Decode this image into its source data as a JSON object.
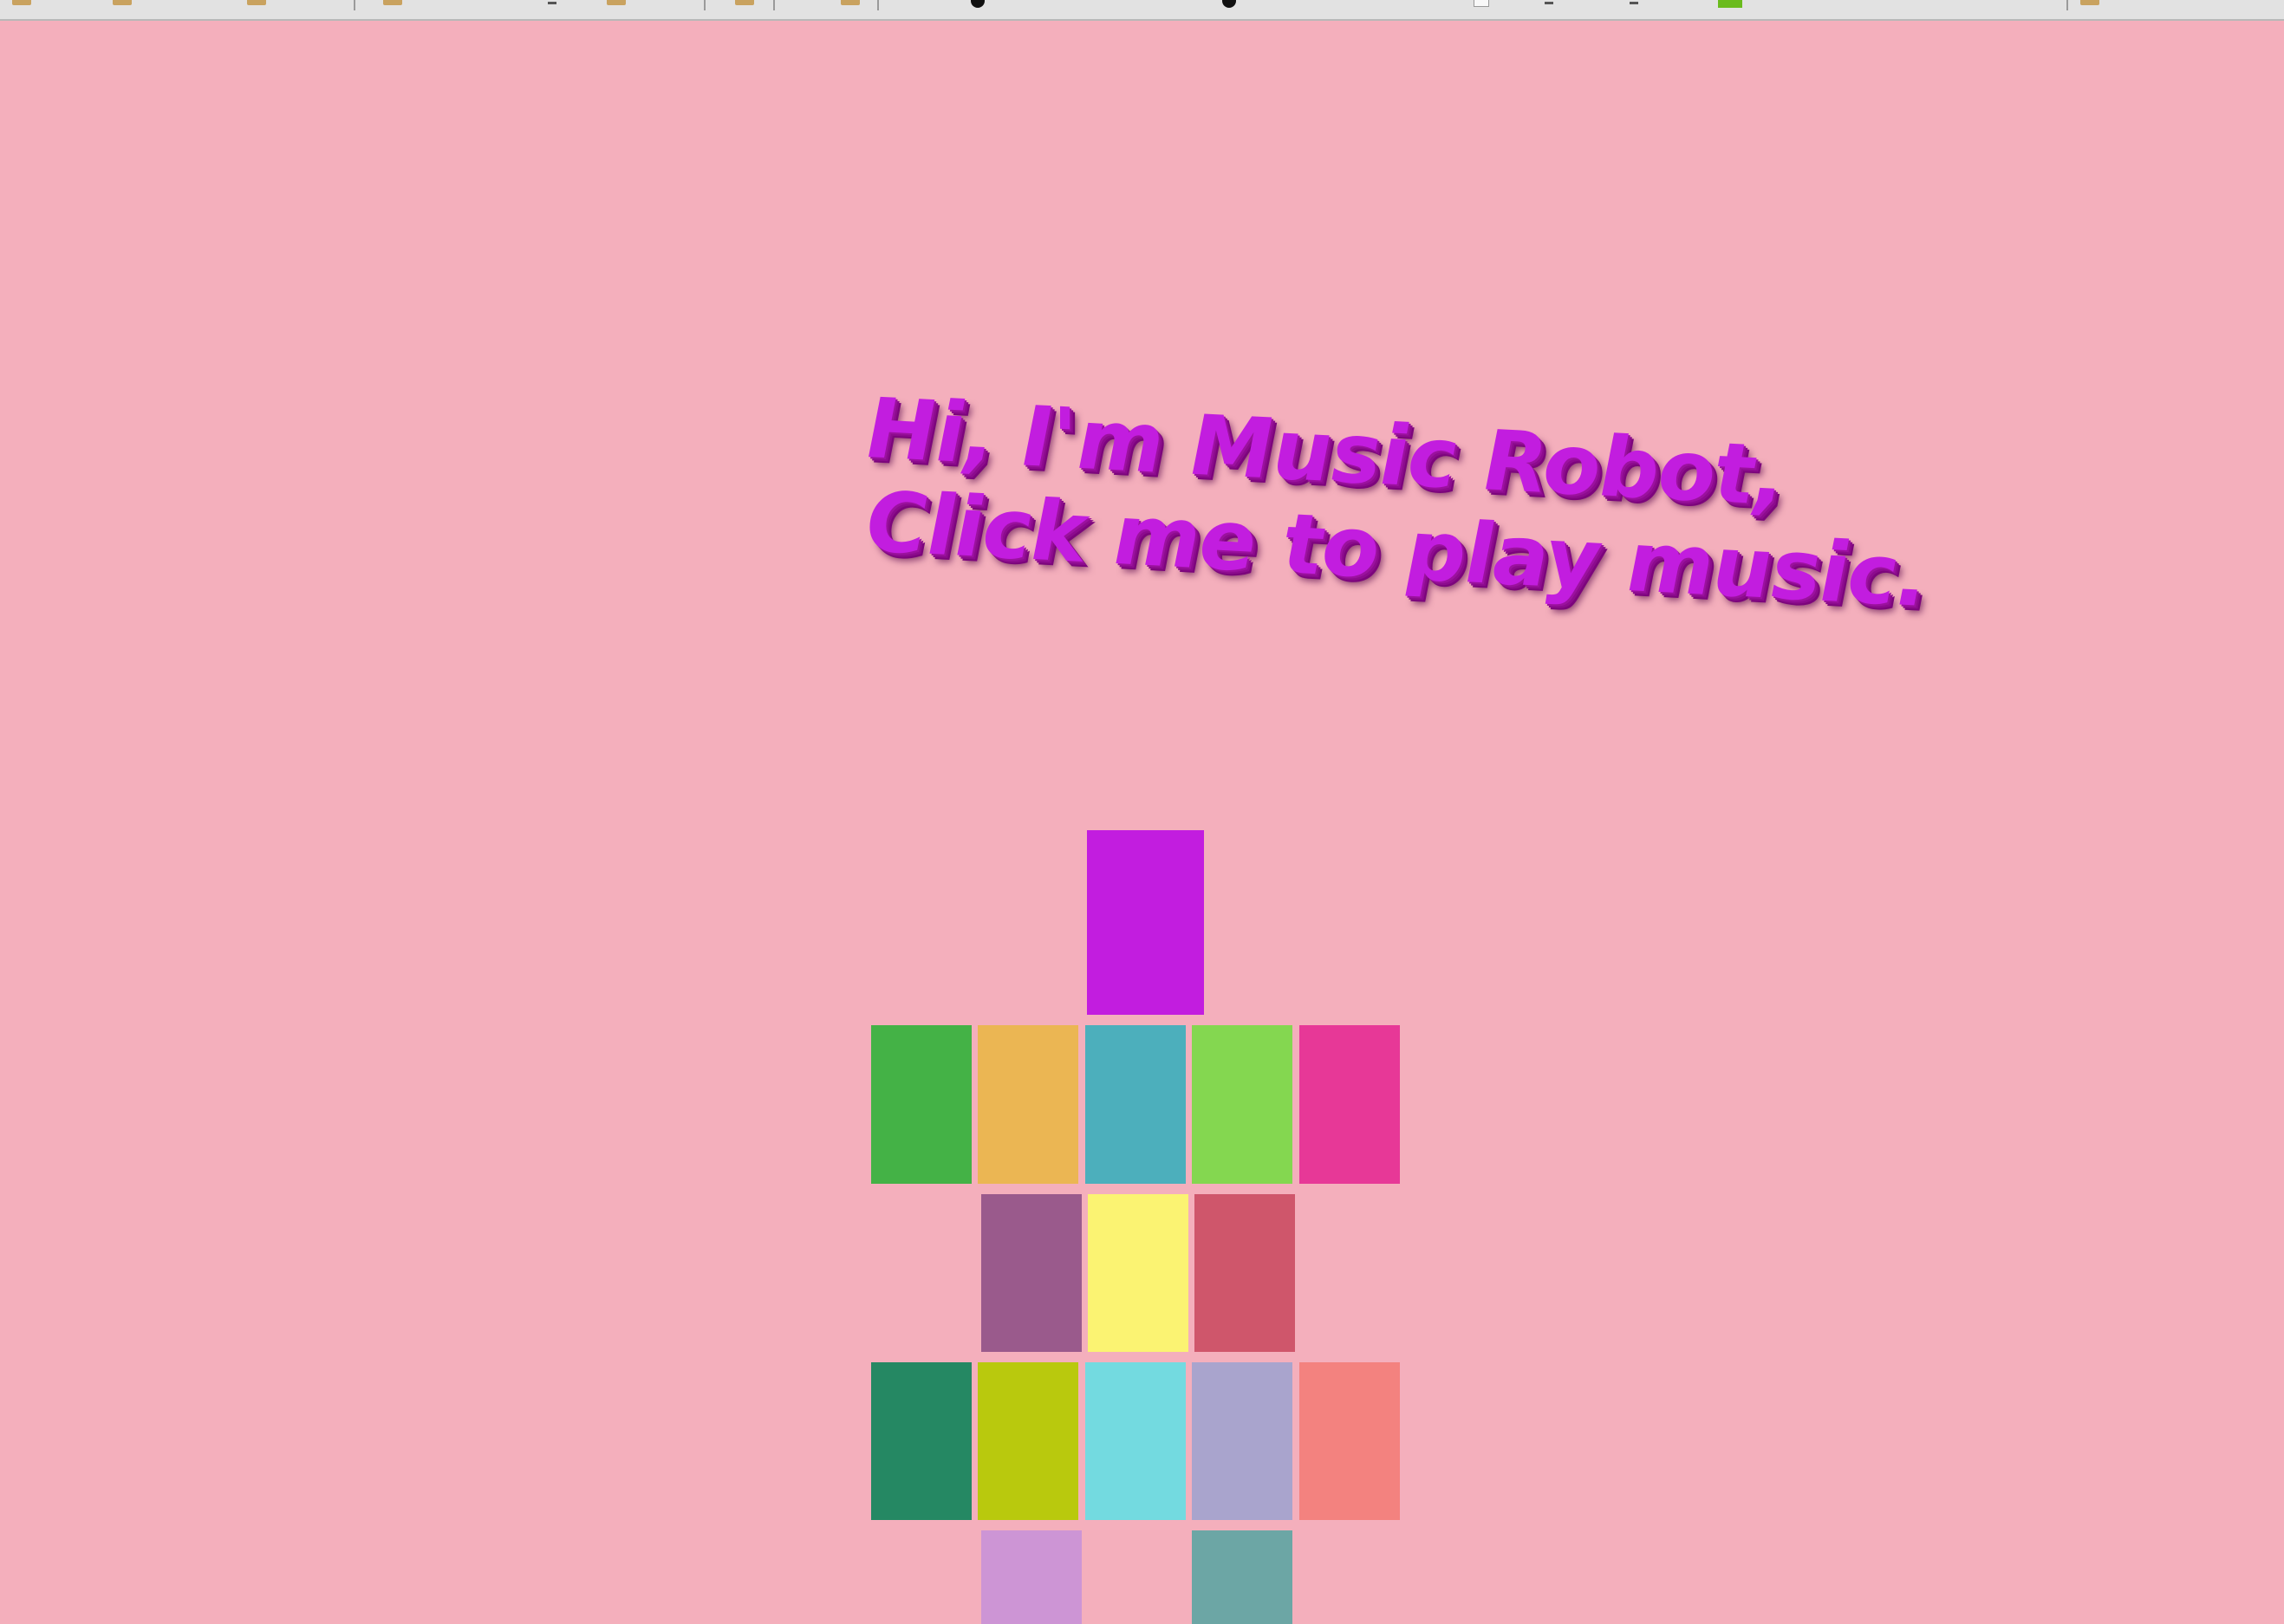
{
  "heading": {
    "line1": "Hi, I'm Music Robot,",
    "line2": "Click me to play music."
  },
  "colors": {
    "background": "#f4afbc",
    "heading": "#c21ddf",
    "head": "#c21ddf",
    "row1": [
      "#44b246",
      "#ebb653",
      "#4cafbc",
      "#84d750",
      "#e73897"
    ],
    "row2": [
      "#9a5a8c",
      "#fbf372",
      "#cf566b"
    ],
    "row3": [
      "#258863",
      "#b9c90d",
      "#73dae0",
      "#a9a4cd",
      "#f3827f"
    ],
    "row4": [
      "#cd95d5",
      "#6ca6a5"
    ]
  },
  "robot": {
    "head": {
      "name": "robot-head",
      "color": "#c21ddf"
    },
    "blocks": [
      {
        "name": "robot-block-1",
        "color": "#44b246"
      },
      {
        "name": "robot-block-2",
        "color": "#ebb653"
      },
      {
        "name": "robot-block-3",
        "color": "#4cafbc"
      },
      {
        "name": "robot-block-4",
        "color": "#84d750"
      },
      {
        "name": "robot-block-5",
        "color": "#e73897"
      },
      {
        "name": "robot-block-6",
        "color": "#9a5a8c"
      },
      {
        "name": "robot-block-7",
        "color": "#fbf372"
      },
      {
        "name": "robot-block-8",
        "color": "#cf566b"
      },
      {
        "name": "robot-block-9",
        "color": "#258863"
      },
      {
        "name": "robot-block-10",
        "color": "#b9c90d"
      },
      {
        "name": "robot-block-11",
        "color": "#73dae0"
      },
      {
        "name": "robot-block-12",
        "color": "#a9a4cd"
      },
      {
        "name": "robot-block-13",
        "color": "#f3827f"
      },
      {
        "name": "robot-block-14",
        "color": "#cd95d5"
      },
      {
        "name": "robot-block-15",
        "color": "#6ca6a5"
      }
    ]
  }
}
